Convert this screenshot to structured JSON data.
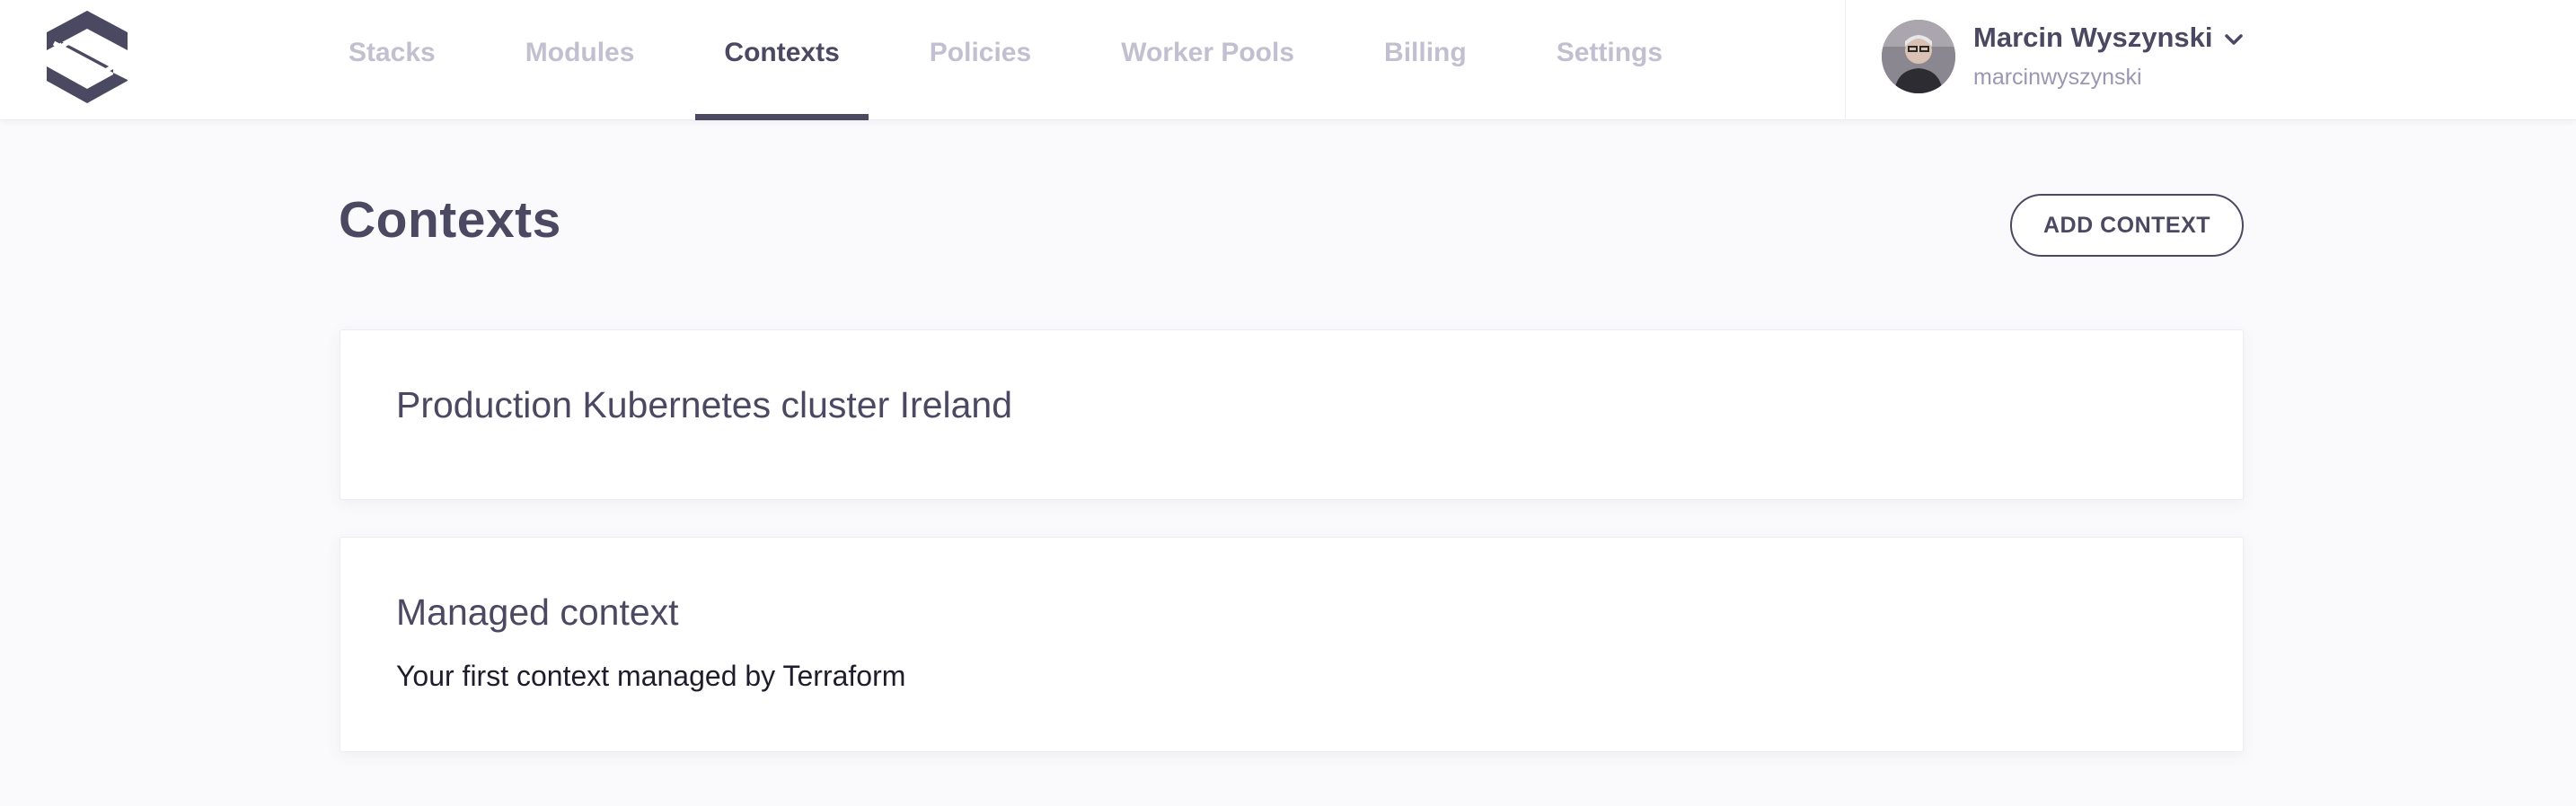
{
  "brand": {
    "logo_icon": "spacelift-logo-icon",
    "color": "#4b4862"
  },
  "nav": {
    "tabs": [
      {
        "label": "Stacks",
        "active": false
      },
      {
        "label": "Modules",
        "active": false
      },
      {
        "label": "Contexts",
        "active": true
      },
      {
        "label": "Policies",
        "active": false
      },
      {
        "label": "Worker Pools",
        "active": false
      },
      {
        "label": "Billing",
        "active": false
      },
      {
        "label": "Settings",
        "active": false
      }
    ]
  },
  "user": {
    "name": "Marcin Wyszynski",
    "handle": "marcinwyszynski",
    "avatar_icon": "user-avatar",
    "menu_icon": "chevron-down-icon"
  },
  "page": {
    "title": "Contexts",
    "add_button_label": "ADD CONTEXT"
  },
  "contexts": [
    {
      "name": "Production Kubernetes cluster Ireland",
      "description": ""
    },
    {
      "name": "Managed context",
      "description": "Your first context managed by Terraform"
    }
  ],
  "colors": {
    "primary_text": "#4b4862",
    "inactive_tab": "#c2c0d0",
    "muted_text": "#9a97b2",
    "page_background": "#fafafc"
  }
}
